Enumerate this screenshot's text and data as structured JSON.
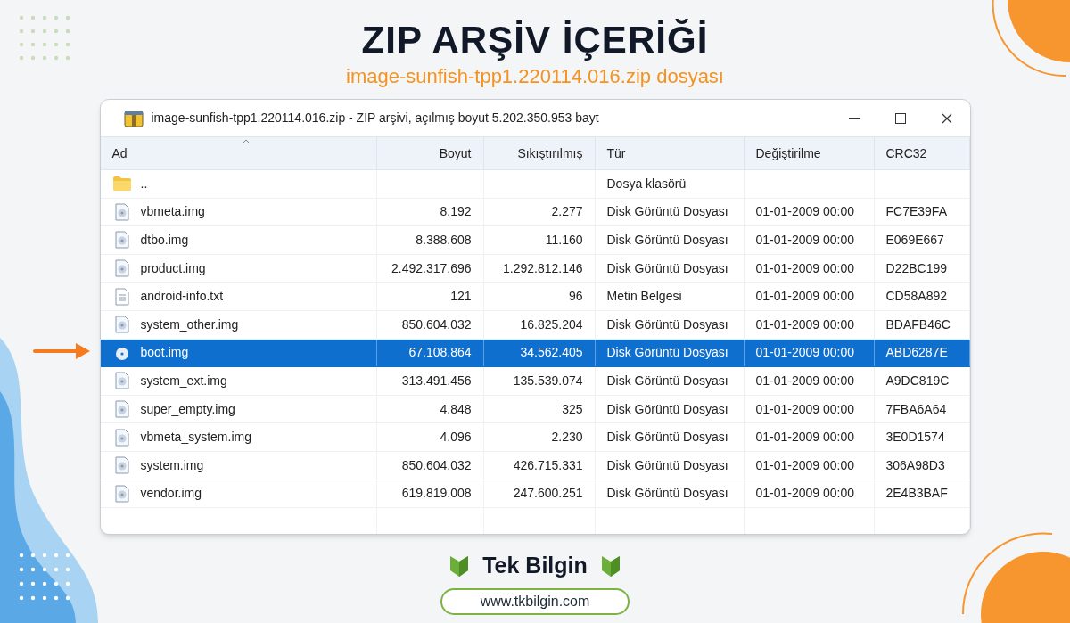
{
  "header": {
    "title": "ZIP ARŞİV İÇERİĞİ",
    "subtitle": "image-sunfish-tpp1.220114.016.zip dosyası"
  },
  "window": {
    "title": "image-sunfish-tpp1.220114.016.zip - ZIP arşivi, açılmış boyut 5.202.350.953 bayt"
  },
  "table": {
    "columns": [
      "Ad",
      "Boyut",
      "Sıkıştırılmış",
      "Tür",
      "Değiştirilme",
      "CRC32"
    ],
    "rows": [
      {
        "kind": "folder",
        "name": "..",
        "size": "",
        "packed": "",
        "type": "Dosya klasörü",
        "modified": "",
        "crc": "",
        "selected": false
      },
      {
        "kind": "disk",
        "name": "vbmeta.img",
        "size": "8.192",
        "packed": "2.277",
        "type": "Disk Görüntü Dosyası",
        "modified": "01-01-2009 00:00",
        "crc": "FC7E39FA",
        "selected": false
      },
      {
        "kind": "disk",
        "name": "dtbo.img",
        "size": "8.388.608",
        "packed": "11.160",
        "type": "Disk Görüntü Dosyası",
        "modified": "01-01-2009 00:00",
        "crc": "E069E667",
        "selected": false
      },
      {
        "kind": "disk",
        "name": "product.img",
        "size": "2.492.317.696",
        "packed": "1.292.812.146",
        "type": "Disk Görüntü Dosyası",
        "modified": "01-01-2009 00:00",
        "crc": "D22BC199",
        "selected": false
      },
      {
        "kind": "text",
        "name": "android-info.txt",
        "size": "121",
        "packed": "96",
        "type": "Metin Belgesi",
        "modified": "01-01-2009 00:00",
        "crc": "CD58A892",
        "selected": false
      },
      {
        "kind": "disk",
        "name": "system_other.img",
        "size": "850.604.032",
        "packed": "16.825.204",
        "type": "Disk Görüntü Dosyası",
        "modified": "01-01-2009 00:00",
        "crc": "BDAFB46C",
        "selected": false
      },
      {
        "kind": "disk",
        "name": "boot.img",
        "size": "67.108.864",
        "packed": "34.562.405",
        "type": "Disk Görüntü Dosyası",
        "modified": "01-01-2009 00:00",
        "crc": "ABD6287E",
        "selected": true
      },
      {
        "kind": "disk",
        "name": "system_ext.img",
        "size": "313.491.456",
        "packed": "135.539.074",
        "type": "Disk Görüntü Dosyası",
        "modified": "01-01-2009 00:00",
        "crc": "A9DC819C",
        "selected": false
      },
      {
        "kind": "disk",
        "name": "super_empty.img",
        "size": "4.848",
        "packed": "325",
        "type": "Disk Görüntü Dosyası",
        "modified": "01-01-2009 00:00",
        "crc": "7FBA6A64",
        "selected": false
      },
      {
        "kind": "disk",
        "name": "vbmeta_system.img",
        "size": "4.096",
        "packed": "2.230",
        "type": "Disk Görüntü Dosyası",
        "modified": "01-01-2009 00:00",
        "crc": "3E0D1574",
        "selected": false
      },
      {
        "kind": "disk",
        "name": "system.img",
        "size": "850.604.032",
        "packed": "426.715.331",
        "type": "Disk Görüntü Dosyası",
        "modified": "01-01-2009 00:00",
        "crc": "306A98D3",
        "selected": false
      },
      {
        "kind": "disk",
        "name": "vendor.img",
        "size": "619.819.008",
        "packed": "247.600.251",
        "type": "Disk Görüntü Dosyası",
        "modified": "01-01-2009 00:00",
        "crc": "2E4B3BAF",
        "selected": false
      }
    ]
  },
  "footer": {
    "brand": "Tek Bilgin",
    "url": "www.tkbilgin.com"
  }
}
